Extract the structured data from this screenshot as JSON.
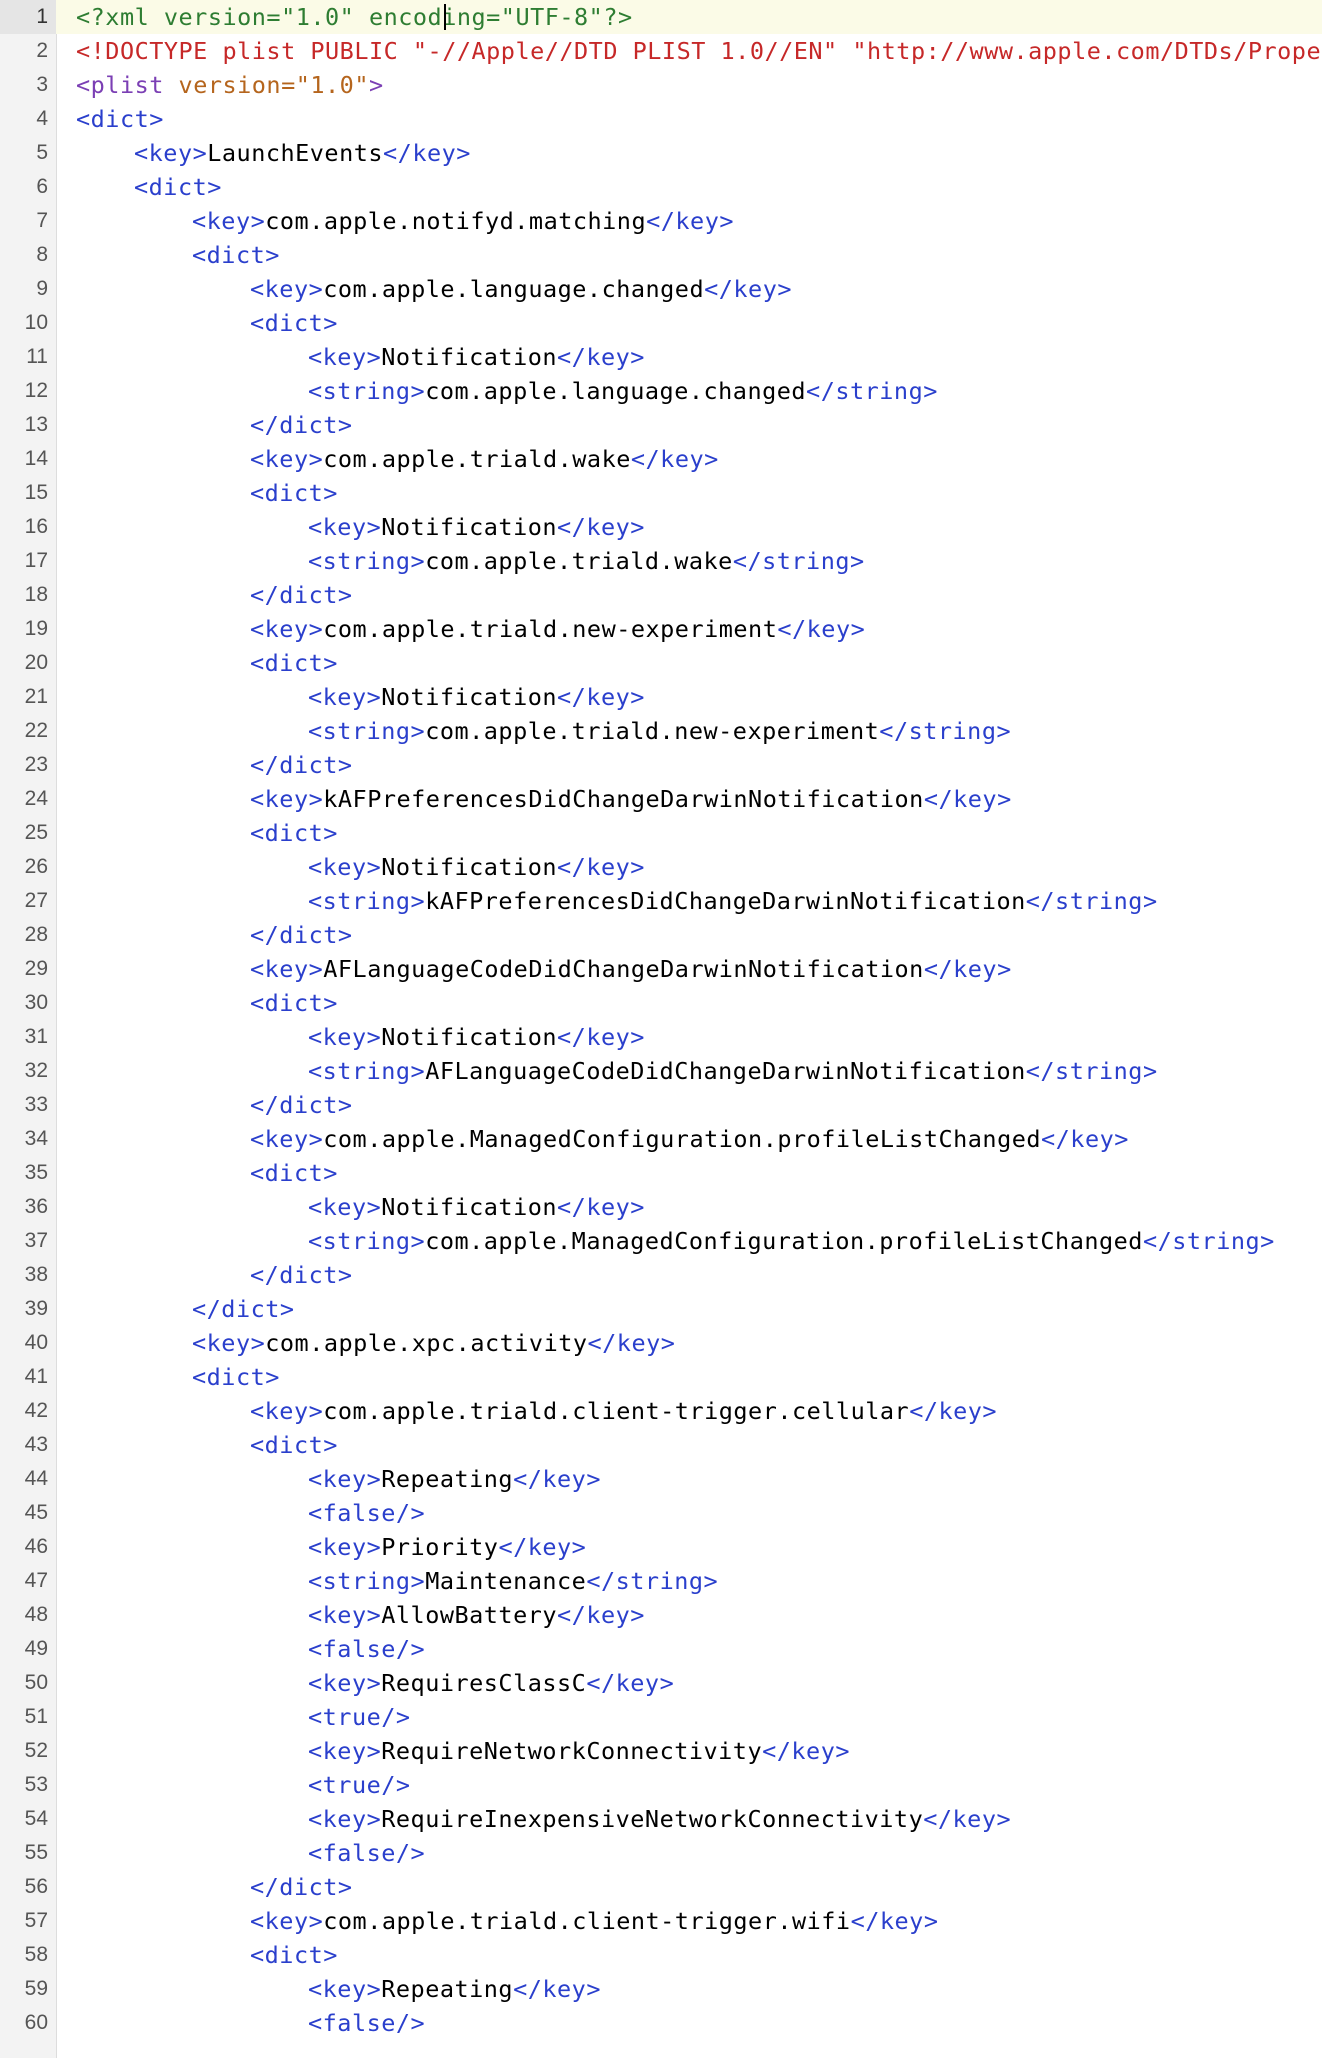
{
  "colors": {
    "tag": "#2a3fcc",
    "text": "#000000",
    "declaration": "#2e7d32",
    "doctype": "#c62828",
    "plist_tag": "#7b3fb4",
    "attr_value": "#b5651d",
    "gutter_bg": "#f3f3f3",
    "current_line_bg": "#fbfbe7"
  },
  "current_line": 1,
  "lines": [
    {
      "n": "1",
      "indent": 0,
      "tokens": [
        {
          "t": "<?xml version=\"1.0\" encoding=\"UTF-8\"?>",
          "k": "decl"
        }
      ]
    },
    {
      "n": "2",
      "indent": 0,
      "tokens": [
        {
          "t": "<!DOCTYPE plist PUBLIC \"-//Apple//DTD PLIST 1.0//EN\" \"http://www.apple.com/DTDs/Propert",
          "k": "doctype"
        }
      ]
    },
    {
      "n": "3",
      "indent": 0,
      "tokens": [
        {
          "t": "<plist ",
          "k": "plist"
        },
        {
          "t": "version=\"1.0\"",
          "k": "attr"
        },
        {
          "t": ">",
          "k": "plist"
        }
      ]
    },
    {
      "n": "4",
      "indent": 0,
      "tokens": [
        {
          "t": "<dict>",
          "k": "tag"
        }
      ]
    },
    {
      "n": "5",
      "indent": 1,
      "tokens": [
        {
          "t": "<key>",
          "k": "tag"
        },
        {
          "t": "LaunchEvents",
          "k": "text"
        },
        {
          "t": "</key>",
          "k": "tag"
        }
      ]
    },
    {
      "n": "6",
      "indent": 1,
      "tokens": [
        {
          "t": "<dict>",
          "k": "tag"
        }
      ]
    },
    {
      "n": "7",
      "indent": 2,
      "tokens": [
        {
          "t": "<key>",
          "k": "tag"
        },
        {
          "t": "com.apple.notifyd.matching",
          "k": "text"
        },
        {
          "t": "</key>",
          "k": "tag"
        }
      ]
    },
    {
      "n": "8",
      "indent": 2,
      "tokens": [
        {
          "t": "<dict>",
          "k": "tag"
        }
      ]
    },
    {
      "n": "9",
      "indent": 3,
      "tokens": [
        {
          "t": "<key>",
          "k": "tag"
        },
        {
          "t": "com.apple.language.changed",
          "k": "text"
        },
        {
          "t": "</key>",
          "k": "tag"
        }
      ]
    },
    {
      "n": "10",
      "indent": 3,
      "tokens": [
        {
          "t": "<dict>",
          "k": "tag"
        }
      ]
    },
    {
      "n": "11",
      "indent": 4,
      "tokens": [
        {
          "t": "<key>",
          "k": "tag"
        },
        {
          "t": "Notification",
          "k": "text"
        },
        {
          "t": "</key>",
          "k": "tag"
        }
      ]
    },
    {
      "n": "12",
      "indent": 4,
      "tokens": [
        {
          "t": "<string>",
          "k": "tag"
        },
        {
          "t": "com.apple.language.changed",
          "k": "text"
        },
        {
          "t": "</string>",
          "k": "tag"
        }
      ]
    },
    {
      "n": "13",
      "indent": 3,
      "tokens": [
        {
          "t": "</dict>",
          "k": "tag"
        }
      ]
    },
    {
      "n": "14",
      "indent": 3,
      "tokens": [
        {
          "t": "<key>",
          "k": "tag"
        },
        {
          "t": "com.apple.triald.wake",
          "k": "text"
        },
        {
          "t": "</key>",
          "k": "tag"
        }
      ]
    },
    {
      "n": "15",
      "indent": 3,
      "tokens": [
        {
          "t": "<dict>",
          "k": "tag"
        }
      ]
    },
    {
      "n": "16",
      "indent": 4,
      "tokens": [
        {
          "t": "<key>",
          "k": "tag"
        },
        {
          "t": "Notification",
          "k": "text"
        },
        {
          "t": "</key>",
          "k": "tag"
        }
      ]
    },
    {
      "n": "17",
      "indent": 4,
      "tokens": [
        {
          "t": "<string>",
          "k": "tag"
        },
        {
          "t": "com.apple.triald.wake",
          "k": "text"
        },
        {
          "t": "</string>",
          "k": "tag"
        }
      ]
    },
    {
      "n": "18",
      "indent": 3,
      "tokens": [
        {
          "t": "</dict>",
          "k": "tag"
        }
      ]
    },
    {
      "n": "19",
      "indent": 3,
      "tokens": [
        {
          "t": "<key>",
          "k": "tag"
        },
        {
          "t": "com.apple.triald.new-experiment",
          "k": "text"
        },
        {
          "t": "</key>",
          "k": "tag"
        }
      ]
    },
    {
      "n": "20",
      "indent": 3,
      "tokens": [
        {
          "t": "<dict>",
          "k": "tag"
        }
      ]
    },
    {
      "n": "21",
      "indent": 4,
      "tokens": [
        {
          "t": "<key>",
          "k": "tag"
        },
        {
          "t": "Notification",
          "k": "text"
        },
        {
          "t": "</key>",
          "k": "tag"
        }
      ]
    },
    {
      "n": "22",
      "indent": 4,
      "tokens": [
        {
          "t": "<string>",
          "k": "tag"
        },
        {
          "t": "com.apple.triald.new-experiment",
          "k": "text"
        },
        {
          "t": "</string>",
          "k": "tag"
        }
      ]
    },
    {
      "n": "23",
      "indent": 3,
      "tokens": [
        {
          "t": "</dict>",
          "k": "tag"
        }
      ]
    },
    {
      "n": "24",
      "indent": 3,
      "tokens": [
        {
          "t": "<key>",
          "k": "tag"
        },
        {
          "t": "kAFPreferencesDidChangeDarwinNotification",
          "k": "text"
        },
        {
          "t": "</key>",
          "k": "tag"
        }
      ]
    },
    {
      "n": "25",
      "indent": 3,
      "tokens": [
        {
          "t": "<dict>",
          "k": "tag"
        }
      ]
    },
    {
      "n": "26",
      "indent": 4,
      "tokens": [
        {
          "t": "<key>",
          "k": "tag"
        },
        {
          "t": "Notification",
          "k": "text"
        },
        {
          "t": "</key>",
          "k": "tag"
        }
      ]
    },
    {
      "n": "27",
      "indent": 4,
      "tokens": [
        {
          "t": "<string>",
          "k": "tag"
        },
        {
          "t": "kAFPreferencesDidChangeDarwinNotification",
          "k": "text"
        },
        {
          "t": "</string>",
          "k": "tag"
        }
      ]
    },
    {
      "n": "28",
      "indent": 3,
      "tokens": [
        {
          "t": "</dict>",
          "k": "tag"
        }
      ]
    },
    {
      "n": "29",
      "indent": 3,
      "tokens": [
        {
          "t": "<key>",
          "k": "tag"
        },
        {
          "t": "AFLanguageCodeDidChangeDarwinNotification",
          "k": "text"
        },
        {
          "t": "</key>",
          "k": "tag"
        }
      ]
    },
    {
      "n": "30",
      "indent": 3,
      "tokens": [
        {
          "t": "<dict>",
          "k": "tag"
        }
      ]
    },
    {
      "n": "31",
      "indent": 4,
      "tokens": [
        {
          "t": "<key>",
          "k": "tag"
        },
        {
          "t": "Notification",
          "k": "text"
        },
        {
          "t": "</key>",
          "k": "tag"
        }
      ]
    },
    {
      "n": "32",
      "indent": 4,
      "tokens": [
        {
          "t": "<string>",
          "k": "tag"
        },
        {
          "t": "AFLanguageCodeDidChangeDarwinNotification",
          "k": "text"
        },
        {
          "t": "</string>",
          "k": "tag"
        }
      ]
    },
    {
      "n": "33",
      "indent": 3,
      "tokens": [
        {
          "t": "</dict>",
          "k": "tag"
        }
      ]
    },
    {
      "n": "34",
      "indent": 3,
      "tokens": [
        {
          "t": "<key>",
          "k": "tag"
        },
        {
          "t": "com.apple.ManagedConfiguration.profileListChanged",
          "k": "text"
        },
        {
          "t": "</key>",
          "k": "tag"
        }
      ]
    },
    {
      "n": "35",
      "indent": 3,
      "tokens": [
        {
          "t": "<dict>",
          "k": "tag"
        }
      ]
    },
    {
      "n": "36",
      "indent": 4,
      "tokens": [
        {
          "t": "<key>",
          "k": "tag"
        },
        {
          "t": "Notification",
          "k": "text"
        },
        {
          "t": "</key>",
          "k": "tag"
        }
      ]
    },
    {
      "n": "37",
      "indent": 4,
      "tokens": [
        {
          "t": "<string>",
          "k": "tag"
        },
        {
          "t": "com.apple.ManagedConfiguration.profileListChanged",
          "k": "text"
        },
        {
          "t": "</string>",
          "k": "tag"
        }
      ]
    },
    {
      "n": "38",
      "indent": 3,
      "tokens": [
        {
          "t": "</dict>",
          "k": "tag"
        }
      ]
    },
    {
      "n": "39",
      "indent": 2,
      "tokens": [
        {
          "t": "</dict>",
          "k": "tag"
        }
      ]
    },
    {
      "n": "40",
      "indent": 2,
      "tokens": [
        {
          "t": "<key>",
          "k": "tag"
        },
        {
          "t": "com.apple.xpc.activity",
          "k": "text"
        },
        {
          "t": "</key>",
          "k": "tag"
        }
      ]
    },
    {
      "n": "41",
      "indent": 2,
      "tokens": [
        {
          "t": "<dict>",
          "k": "tag"
        }
      ]
    },
    {
      "n": "42",
      "indent": 3,
      "tokens": [
        {
          "t": "<key>",
          "k": "tag"
        },
        {
          "t": "com.apple.triald.client-trigger.cellular",
          "k": "text"
        },
        {
          "t": "</key>",
          "k": "tag"
        }
      ]
    },
    {
      "n": "43",
      "indent": 3,
      "tokens": [
        {
          "t": "<dict>",
          "k": "tag"
        }
      ]
    },
    {
      "n": "44",
      "indent": 4,
      "tokens": [
        {
          "t": "<key>",
          "k": "tag"
        },
        {
          "t": "Repeating",
          "k": "text"
        },
        {
          "t": "</key>",
          "k": "tag"
        }
      ]
    },
    {
      "n": "45",
      "indent": 4,
      "tokens": [
        {
          "t": "<false/>",
          "k": "tag"
        }
      ]
    },
    {
      "n": "46",
      "indent": 4,
      "tokens": [
        {
          "t": "<key>",
          "k": "tag"
        },
        {
          "t": "Priority",
          "k": "text"
        },
        {
          "t": "</key>",
          "k": "tag"
        }
      ]
    },
    {
      "n": "47",
      "indent": 4,
      "tokens": [
        {
          "t": "<string>",
          "k": "tag"
        },
        {
          "t": "Maintenance",
          "k": "text"
        },
        {
          "t": "</string>",
          "k": "tag"
        }
      ]
    },
    {
      "n": "48",
      "indent": 4,
      "tokens": [
        {
          "t": "<key>",
          "k": "tag"
        },
        {
          "t": "AllowBattery",
          "k": "text"
        },
        {
          "t": "</key>",
          "k": "tag"
        }
      ]
    },
    {
      "n": "49",
      "indent": 4,
      "tokens": [
        {
          "t": "<false/>",
          "k": "tag"
        }
      ]
    },
    {
      "n": "50",
      "indent": 4,
      "tokens": [
        {
          "t": "<key>",
          "k": "tag"
        },
        {
          "t": "RequiresClassC",
          "k": "text"
        },
        {
          "t": "</key>",
          "k": "tag"
        }
      ]
    },
    {
      "n": "51",
      "indent": 4,
      "tokens": [
        {
          "t": "<true/>",
          "k": "tag"
        }
      ]
    },
    {
      "n": "52",
      "indent": 4,
      "tokens": [
        {
          "t": "<key>",
          "k": "tag"
        },
        {
          "t": "RequireNetworkConnectivity",
          "k": "text"
        },
        {
          "t": "</key>",
          "k": "tag"
        }
      ]
    },
    {
      "n": "53",
      "indent": 4,
      "tokens": [
        {
          "t": "<true/>",
          "k": "tag"
        }
      ]
    },
    {
      "n": "54",
      "indent": 4,
      "tokens": [
        {
          "t": "<key>",
          "k": "tag"
        },
        {
          "t": "RequireInexpensiveNetworkConnectivity",
          "k": "text"
        },
        {
          "t": "</key>",
          "k": "tag"
        }
      ]
    },
    {
      "n": "55",
      "indent": 4,
      "tokens": [
        {
          "t": "<false/>",
          "k": "tag"
        }
      ]
    },
    {
      "n": "56",
      "indent": 3,
      "tokens": [
        {
          "t": "</dict>",
          "k": "tag"
        }
      ]
    },
    {
      "n": "57",
      "indent": 3,
      "tokens": [
        {
          "t": "<key>",
          "k": "tag"
        },
        {
          "t": "com.apple.triald.client-trigger.wifi",
          "k": "text"
        },
        {
          "t": "</key>",
          "k": "tag"
        }
      ]
    },
    {
      "n": "58",
      "indent": 3,
      "tokens": [
        {
          "t": "<dict>",
          "k": "tag"
        }
      ]
    },
    {
      "n": "59",
      "indent": 4,
      "tokens": [
        {
          "t": "<key>",
          "k": "tag"
        },
        {
          "t": "Repeating",
          "k": "text"
        },
        {
          "t": "</key>",
          "k": "tag"
        }
      ]
    },
    {
      "n": "60",
      "indent": 4,
      "tokens": [
        {
          "t": "<false/>",
          "k": "tag"
        }
      ]
    }
  ]
}
